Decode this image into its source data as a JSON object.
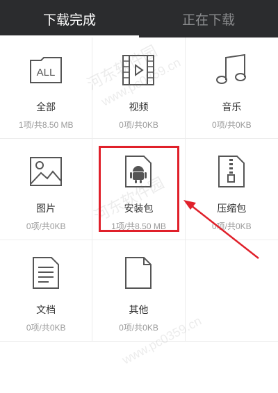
{
  "tabs": [
    {
      "label": "下载完成",
      "active": true
    },
    {
      "label": "正在下载",
      "active": false
    }
  ],
  "categories": [
    {
      "label": "全部",
      "sub": "1项/共8.50 MB",
      "icon": "all-icon"
    },
    {
      "label": "视频",
      "sub": "0项/共0KB",
      "icon": "video-icon"
    },
    {
      "label": "音乐",
      "sub": "0项/共0KB",
      "icon": "music-icon"
    },
    {
      "label": "图片",
      "sub": "0项/共0KB",
      "icon": "image-icon"
    },
    {
      "label": "安装包",
      "sub": "1项/共8.50 MB",
      "icon": "android-apk-icon"
    },
    {
      "label": "压缩包",
      "sub": "0项/共0KB",
      "icon": "zip-icon"
    },
    {
      "label": "文档",
      "sub": "0项/共0KB",
      "icon": "document-icon"
    },
    {
      "label": "其他",
      "sub": "0项/共0KB",
      "icon": "file-icon"
    }
  ],
  "all_icon_text": "ALL",
  "colors": {
    "tabbar": "#2b2c2e",
    "highlight": "#e0202a"
  },
  "watermark": {
    "text": "河东软件园",
    "url": "www.pc0359.cn"
  }
}
